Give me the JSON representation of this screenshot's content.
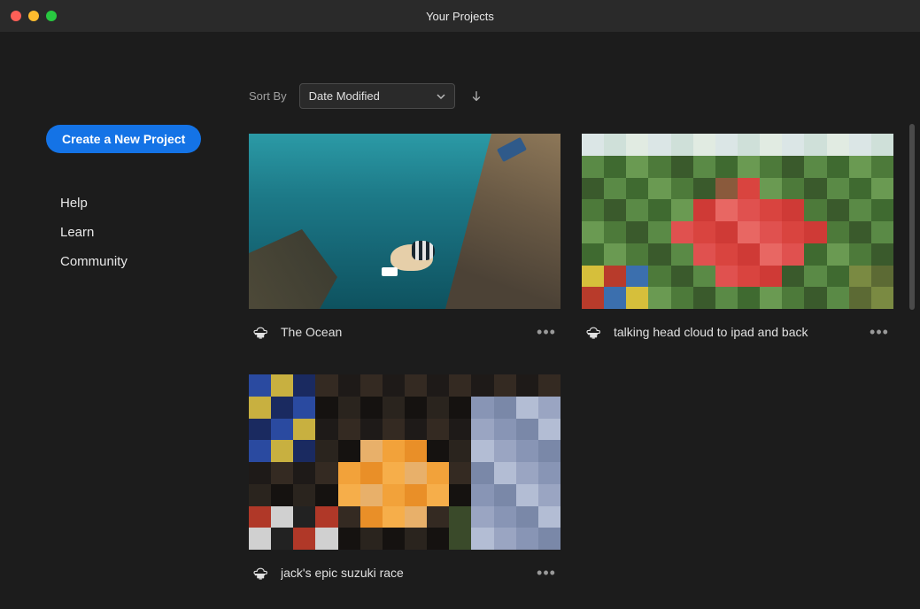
{
  "window": {
    "title": "Your Projects"
  },
  "sidebar": {
    "create_label": "Create a New Project",
    "items": [
      {
        "label": "Help"
      },
      {
        "label": "Learn"
      },
      {
        "label": "Community"
      }
    ]
  },
  "sort": {
    "label": "Sort By",
    "selected": "Date Modified",
    "direction": "descending"
  },
  "projects": [
    {
      "title": "The Ocean"
    },
    {
      "title": "talking head cloud to ipad and back"
    },
    {
      "title": "jack's epic suzuki race"
    }
  ]
}
